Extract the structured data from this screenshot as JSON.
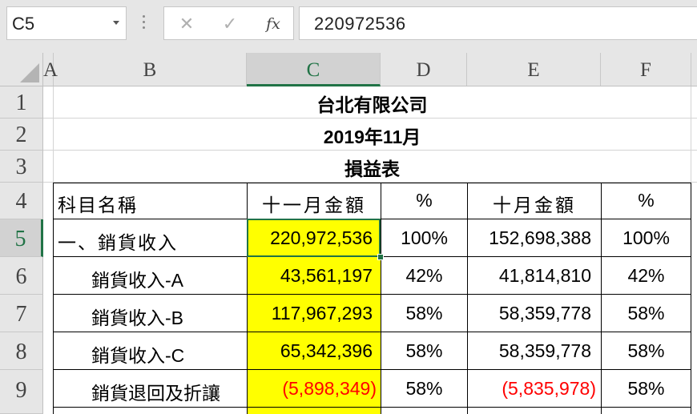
{
  "formula_bar": {
    "name_box": "C5",
    "cancel_icon": "✕",
    "enter_icon": "✓",
    "fx_label": "fx",
    "formula_value": "220972536"
  },
  "columns": [
    "A",
    "B",
    "C",
    "D",
    "E",
    "F"
  ],
  "rows": [
    "1",
    "2",
    "3",
    "4",
    "5",
    "6",
    "7",
    "8",
    "9"
  ],
  "sheet": {
    "title": "台北有限公司",
    "period": "2019年11月",
    "report_name": "損益表",
    "headers": {
      "item": "科目名稱",
      "nov_amount": "十一月金額",
      "nov_pct": "%",
      "oct_amount": "十月金額",
      "oct_pct": "%"
    },
    "lines": [
      {
        "item": "一、銷貨收入",
        "nov": "220,972,536",
        "nov_pct": "100%",
        "oct": "152,698,388",
        "oct_pct": "100%"
      },
      {
        "item": "銷貨收入-A",
        "nov": "43,561,197",
        "nov_pct": "42%",
        "oct": "41,814,810",
        "oct_pct": "42%"
      },
      {
        "item": "銷貨收入-B",
        "nov": "117,967,293",
        "nov_pct": "58%",
        "oct": "58,359,778",
        "oct_pct": "58%"
      },
      {
        "item": "銷貨收入-C",
        "nov": "65,342,396",
        "nov_pct": "58%",
        "oct": "58,359,778",
        "oct_pct": "58%"
      },
      {
        "item": "銷貨退回及折讓",
        "nov": "(5,898,349)",
        "nov_pct": "58%",
        "oct": "(5,835,978)",
        "oct_pct": "58%"
      }
    ]
  },
  "colors": {
    "accent": "#217346",
    "highlight": "#ffff00",
    "negative": "#ff0000"
  }
}
